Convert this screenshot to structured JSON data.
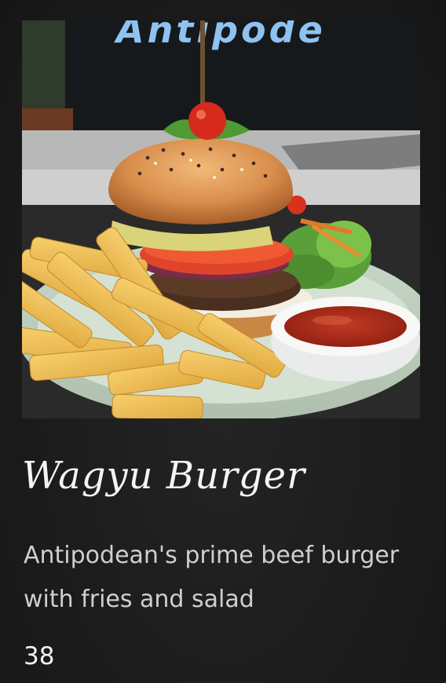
{
  "image": {
    "alt": "Wagyu Burger",
    "sign_text": "Antipode"
  },
  "item": {
    "name": "Wagyu Burger",
    "description": "Antipodean's prime beef burger with fries and salad",
    "price": "38"
  }
}
